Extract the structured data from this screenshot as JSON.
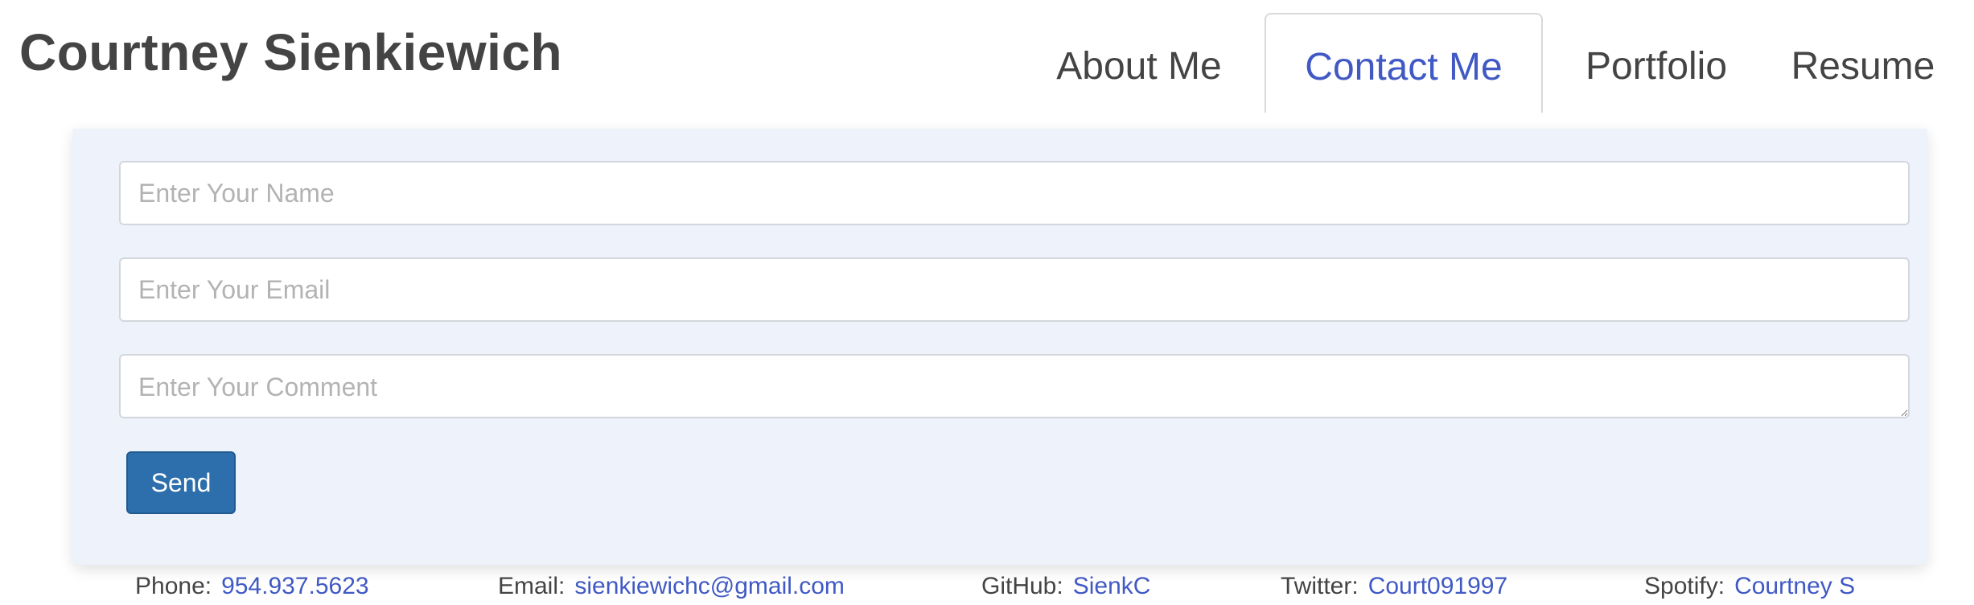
{
  "header": {
    "title": "Courtney Sienkiewich"
  },
  "nav": {
    "tabs": [
      {
        "label": "About Me",
        "active": false
      },
      {
        "label": "Contact Me",
        "active": true
      },
      {
        "label": "Portfolio",
        "active": false
      },
      {
        "label": "Resume",
        "active": false
      }
    ]
  },
  "form": {
    "name_placeholder": "Enter Your Name",
    "email_placeholder": "Enter Your Email",
    "comment_placeholder": "Enter Your Comment",
    "send_label": "Send"
  },
  "footer": {
    "phone": {
      "label": "Phone:",
      "value": "954.937.5623"
    },
    "email": {
      "label": "Email:",
      "value": "sienkiewichc@gmail.com"
    },
    "github": {
      "label": "GitHub:",
      "value": "SienkC"
    },
    "twitter": {
      "label": "Twitter:",
      "value": "Court091997"
    },
    "spotify": {
      "label": "Spotify:",
      "value": "Courtney S"
    }
  },
  "colors": {
    "accent": "#4059c4",
    "button": "#2d6fac",
    "card_background": "#eef3fb",
    "text": "#444444"
  }
}
